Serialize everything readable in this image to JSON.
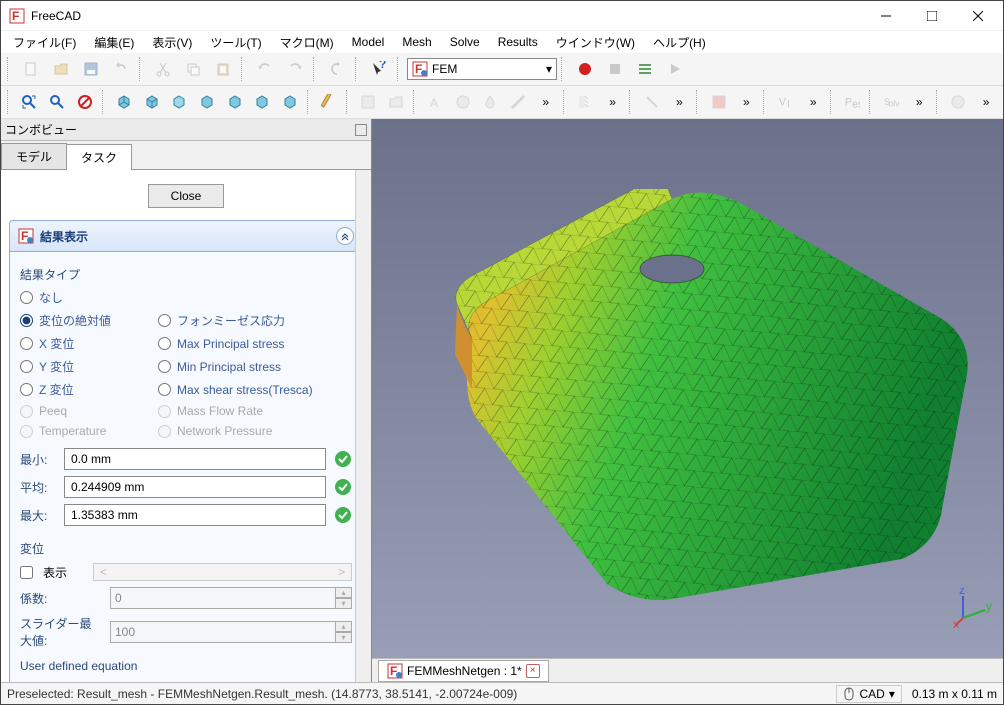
{
  "window": {
    "title": "FreeCAD"
  },
  "menu": [
    "ファイル(F)",
    "編集(E)",
    "表示(V)",
    "ツール(T)",
    "マクロ(M)",
    "Model",
    "Mesh",
    "Solve",
    "Results",
    "ウインドウ(W)",
    "ヘルプ(H)"
  ],
  "workbench": {
    "label": "FEM"
  },
  "combo": {
    "title": "コンボビュー"
  },
  "tabs": {
    "model": "モデル",
    "task": "タスク"
  },
  "task": {
    "close": "Close",
    "header": "結果表示",
    "type_label": "結果タイプ",
    "radios": {
      "none": "なし",
      "abs": "変位の絶対値",
      "vm": "フォンミーゼス応力",
      "x": "X 変位",
      "maxp": "Max Principal stress",
      "y": "Y 変位",
      "minp": "Min Principal stress",
      "z": "Z 変位",
      "maxs": "Max shear stress(Tresca)",
      "peeq": "Peeq",
      "mfr": "Mass Flow Rate",
      "temp": "Temperature",
      "np": "Network Pressure"
    },
    "stats": {
      "min_lbl": "最小:",
      "min_val": "0.0 mm",
      "avg_lbl": "平均:",
      "avg_val": "0.244909 mm",
      "max_lbl": "最大:",
      "max_val": "1.35383 mm"
    },
    "disp": {
      "group": "変位",
      "show": "表示",
      "factor": "係数:",
      "factor_val": "0",
      "smax": "スライダー最大値:",
      "smax_val": "100"
    },
    "ud": "User defined equation"
  },
  "doc": {
    "name": "FEMMeshNetgen : 1*"
  },
  "status": {
    "msg": "Preselected: Result_mesh - FEMMeshNetgen.Result_mesh. (14.8773, 38.5141, -2.00724e-009)",
    "mode": "CAD",
    "dim": "0.13 m x 0.11 m"
  },
  "icons": {
    "overflow": "»"
  }
}
